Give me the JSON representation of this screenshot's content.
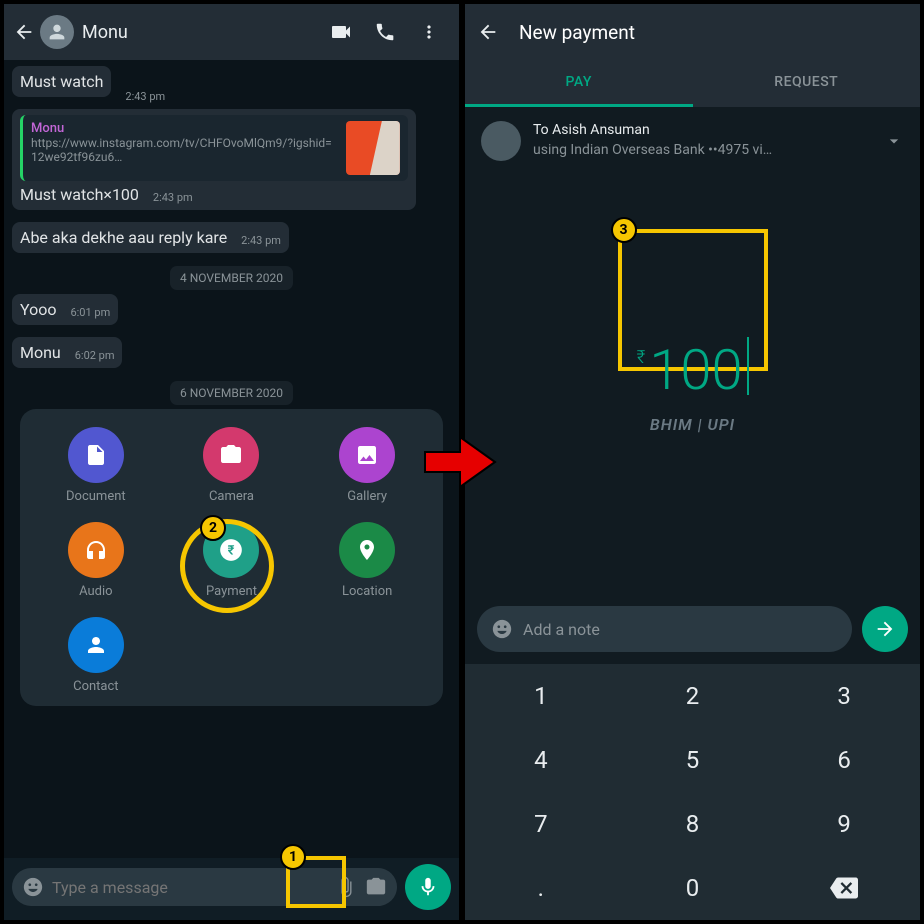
{
  "left": {
    "header": {
      "name": "Monu"
    },
    "messages": [
      {
        "text": "Must watch",
        "time": "2:43 pm"
      }
    ],
    "quoted": {
      "name": "Monu",
      "link": "https://www.instagram.com/tv/CHFOvoMlQm9/?igshid=12we92tf96zu6…",
      "caption": "Must watch×100",
      "time": "2:43 pm"
    },
    "msg3": {
      "text": "Abe aka dekhe aau reply kare",
      "time": "2:43 pm"
    },
    "date1": "4 NOVEMBER 2020",
    "msg4": {
      "text": "Yooo",
      "time": "6:01 pm"
    },
    "msg5": {
      "text": "Monu",
      "time": "6:02 pm"
    },
    "date2": "6 NOVEMBER 2020",
    "attach": {
      "document": "Document",
      "camera": "Camera",
      "gallery": "Gallery",
      "audio": "Audio",
      "payment": "Payment",
      "location": "Location",
      "contact": "Contact"
    },
    "input_placeholder": "Type a message"
  },
  "right": {
    "title": "New payment",
    "tab_pay": "PAY",
    "tab_request": "REQUEST",
    "to_line": "To Asish Ansuman",
    "using_line": "using Indian Overseas Bank ••4975 vi…",
    "amount": "100",
    "currency": "₹",
    "upi": "BHIM | UPI",
    "note_placeholder": "Add a note",
    "keys": [
      "1",
      "2",
      "3",
      "4",
      "5",
      "6",
      "7",
      "8",
      "9",
      ".",
      "0",
      "⌫"
    ]
  },
  "annotations": {
    "a1": "1",
    "a2": "2",
    "a3": "3"
  }
}
